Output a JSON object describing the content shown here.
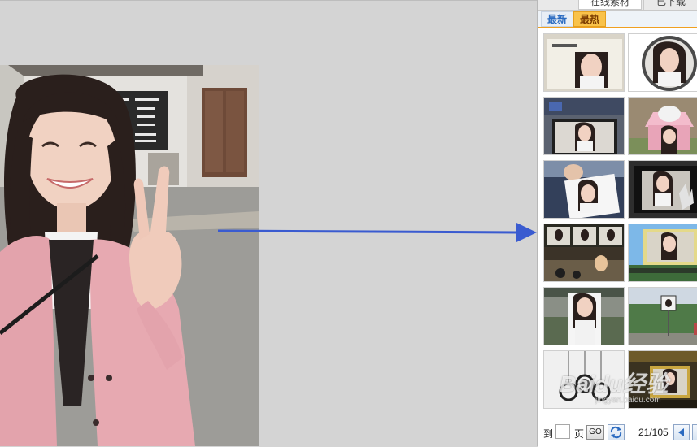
{
  "panel": {
    "top_tabs": [
      "在线素材",
      "已下载"
    ],
    "sub_tabs": [
      "最新",
      "最热"
    ],
    "active_sub_tab": "最热",
    "thumbnails": [
      "thumb-newspaper-frame",
      "thumb-round-vignette",
      "thumb-tv-screen",
      "thumb-gift-box",
      "thumb-photo-in-hand",
      "thumb-monitor-hand",
      "thumb-film-strip",
      "thumb-billboard-landscape",
      "thumb-street-poster",
      "thumb-park-sign",
      "thumb-hanging-frames",
      "thumb-framed-portrait"
    ]
  },
  "pager": {
    "goto_label": "到",
    "page_input_value": "",
    "page_label": "页",
    "go_label": "GO",
    "counter": "21/105"
  },
  "watermark": {
    "text": "Baidu经验",
    "sub": "jingyan.baidu.com"
  },
  "colors": {
    "canvas_bg": "#d4d4d4",
    "arrow": "#3a5bd0",
    "accent_tab": "#f9c24a",
    "latest_tab_text": "#2a6ac0"
  }
}
